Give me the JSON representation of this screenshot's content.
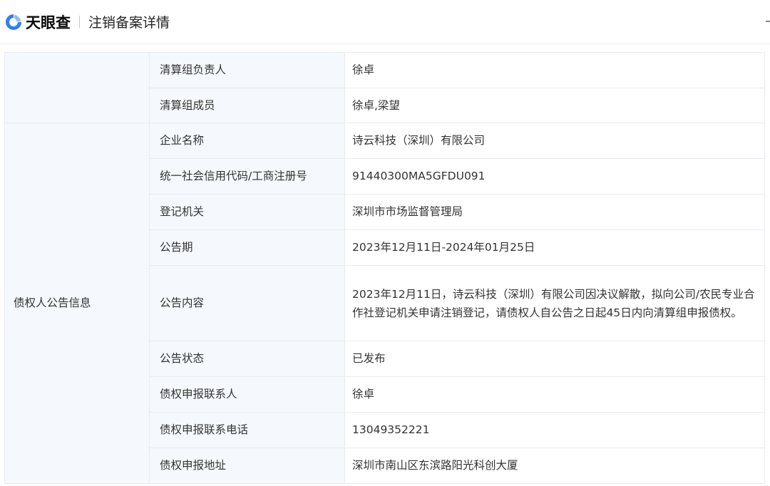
{
  "header": {
    "brand": "天眼查",
    "title": "注销备案详情",
    "edge_char": "―"
  },
  "colors": {
    "brand_blue": "#2f7ef5",
    "label_bg": "#f5f8fd",
    "border": "#e6ebf3"
  },
  "rows_top": [
    {
      "label": "清算组负责人",
      "value": "徐卓"
    },
    {
      "label": "清算组成员",
      "value": "徐卓,梁望"
    }
  ],
  "creditor_group": {
    "title": "债权人公告信息",
    "rows": [
      {
        "label": "企业名称",
        "value": "诗云科技（深圳）有限公司"
      },
      {
        "label": "统一社会信用代码/工商注册号",
        "value": "91440300MA5GFDU091"
      },
      {
        "label": "登记机关",
        "value": "深圳市市场监督管理局"
      },
      {
        "label": "公告期",
        "value": "2023年12月11日-2024年01月25日"
      },
      {
        "label": "公告内容",
        "value": "2023年12月11日，诗云科技（深圳）有限公司因决议解散，拟向公司/农民专业合作社登记机关申请注销登记，请债权人自公告之日起45日内向清算组申报债权。"
      },
      {
        "label": "公告状态",
        "value": "已发布"
      },
      {
        "label": "债权申报联系人",
        "value": "徐卓"
      },
      {
        "label": "债权申报联系电话",
        "value": "13049352221"
      },
      {
        "label": "债权申报地址",
        "value": "深圳市南山区东滨路阳光科创大厦"
      }
    ]
  }
}
